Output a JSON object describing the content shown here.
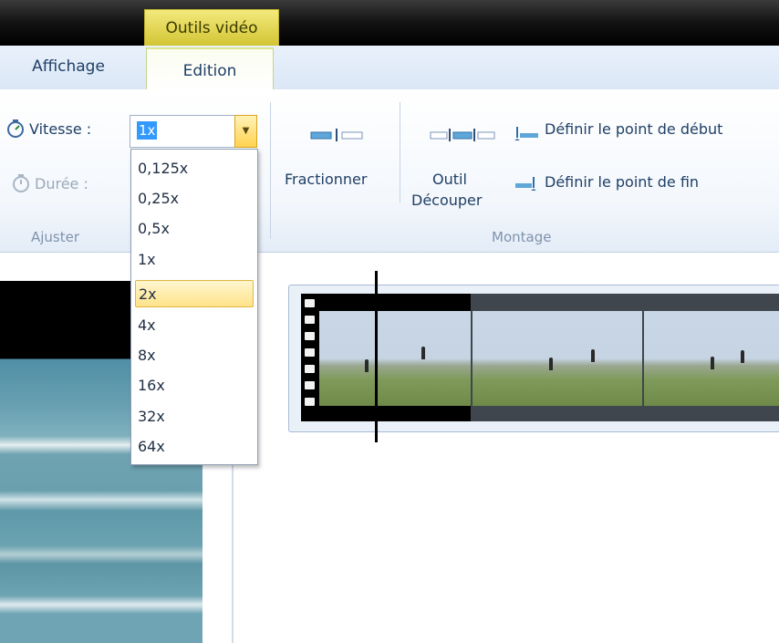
{
  "title_bar": {
    "context_tab": "Outils vidéo"
  },
  "tabs": [
    {
      "label": "Affichage",
      "active": false
    },
    {
      "label": "Edition",
      "active": true
    }
  ],
  "ribbon": {
    "ajuster": {
      "label": "Ajuster",
      "speed_label": "Vitesse :",
      "speed_value": "1x",
      "duration_label": "Durée :"
    },
    "fractionner": {
      "label": "Fractionner"
    },
    "montage": {
      "label": "Montage",
      "outil_line1": "Outil",
      "outil_line2": "Découper",
      "start_point": "Définir le point de début",
      "end_point": "Définir le point de fin"
    }
  },
  "speed_dropdown": {
    "options": [
      "0,125x",
      "0,25x",
      "0,5x",
      "1x",
      "2x",
      "4x",
      "8x",
      "16x",
      "32x",
      "64x"
    ],
    "highlighted": "2x"
  },
  "colors": {
    "accent_context_tab": "#d2c534",
    "selection": "#3399ff",
    "hover_item": "#ffe38a"
  }
}
